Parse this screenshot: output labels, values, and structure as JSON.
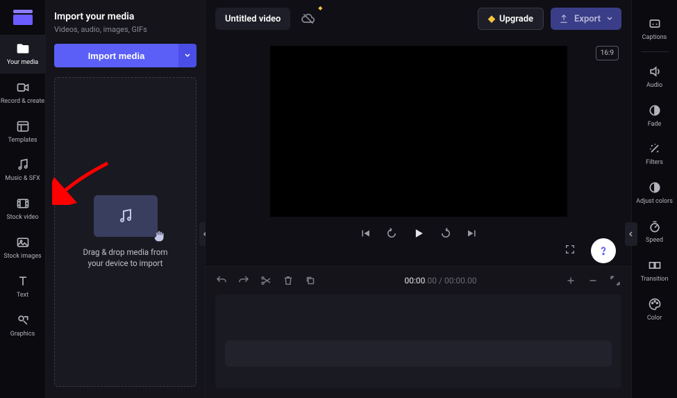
{
  "left_rail": {
    "items": [
      {
        "label": "Your media"
      },
      {
        "label": "Record & create"
      },
      {
        "label": "Templates"
      },
      {
        "label": "Music & SFX"
      },
      {
        "label": "Stock video"
      },
      {
        "label": "Stock images"
      },
      {
        "label": "Text"
      },
      {
        "label": "Graphics"
      }
    ]
  },
  "media_panel": {
    "title": "Import your media",
    "subtitle": "Videos, audio, images, GIFs",
    "import_label": "Import media",
    "drop_line1": "Drag & drop media from",
    "drop_line2": "your device to import"
  },
  "topbar": {
    "title": "Untitled video",
    "upgrade_label": "Upgrade",
    "export_label": "Export"
  },
  "preview": {
    "ratio": "16:9"
  },
  "timeline": {
    "current": "00:00",
    "current_frac": ".00",
    "sep": " / ",
    "total": "00:00",
    "total_frac": ".00"
  },
  "right_rail": {
    "items": [
      {
        "label": "Captions"
      },
      {
        "label": "Audio"
      },
      {
        "label": "Fade"
      },
      {
        "label": "Filters"
      },
      {
        "label": "Adjust colors"
      },
      {
        "label": "Speed"
      },
      {
        "label": "Transition"
      },
      {
        "label": "Color"
      }
    ]
  }
}
